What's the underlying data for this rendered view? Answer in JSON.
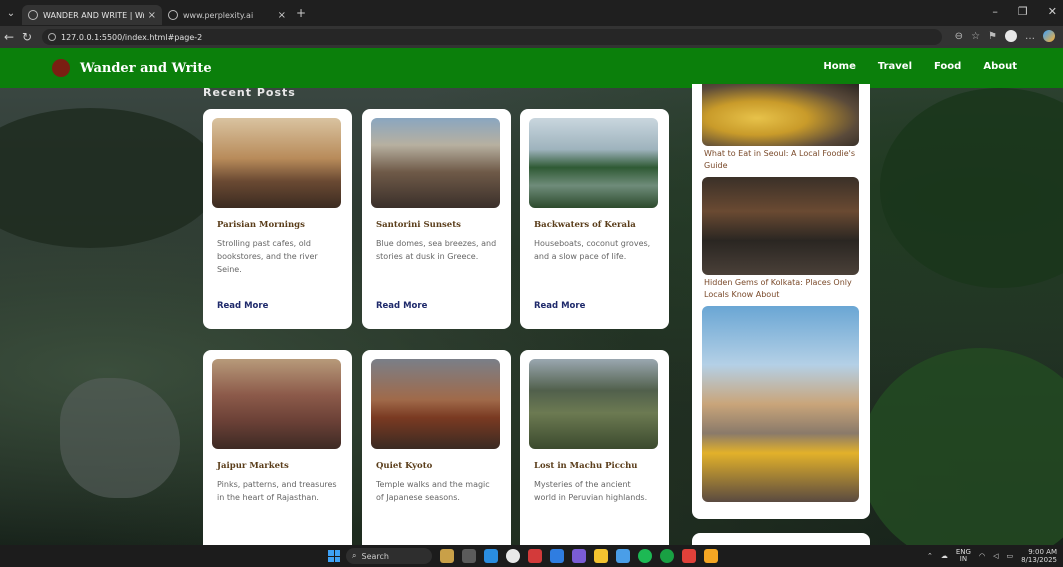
{
  "browser": {
    "tabs": [
      {
        "title": "WANDER AND WRITE | Write Your",
        "active": true
      },
      {
        "title": "www.perplexity.ai",
        "active": false
      }
    ],
    "url": "127.0.0.1:5500/index.html#page-2"
  },
  "site": {
    "brand": "Wander and Write",
    "nav": [
      "Home",
      "Travel",
      "Food",
      "About"
    ]
  },
  "recent": {
    "heading": "Recent Posts",
    "read_more": "Read More",
    "posts": [
      {
        "title": "Parisian Mornings",
        "desc": "Strolling past cafes, old bookstores, and the river Seine."
      },
      {
        "title": "Santorini Sunsets",
        "desc": "Blue domes, sea breezes, and stories at dusk in Greece."
      },
      {
        "title": "Backwaters of Kerala",
        "desc": "Houseboats, coconut groves, and a slow pace of life."
      },
      {
        "title": "Jaipur Markets",
        "desc": "Pinks, patterns, and treasures in the heart of Rajasthan."
      },
      {
        "title": "Quiet Kyoto",
        "desc": "Temple walks and the magic of Japanese seasons."
      },
      {
        "title": "Lost in Machu Picchu",
        "desc": "Mysteries of the ancient world in Peruvian highlands."
      }
    ]
  },
  "sidebar": {
    "items": [
      {
        "caption": "What to Eat in Seoul: A Local Foodie's Guide"
      },
      {
        "caption": "Hidden Gems of Kolkata: Places Only Locals Know About"
      },
      {
        "caption": ""
      }
    ]
  },
  "taskbar": {
    "search_placeholder": "Search",
    "lang": "ENG",
    "region": "IN",
    "time": "9:00 AM",
    "date": "8/13/2025"
  }
}
